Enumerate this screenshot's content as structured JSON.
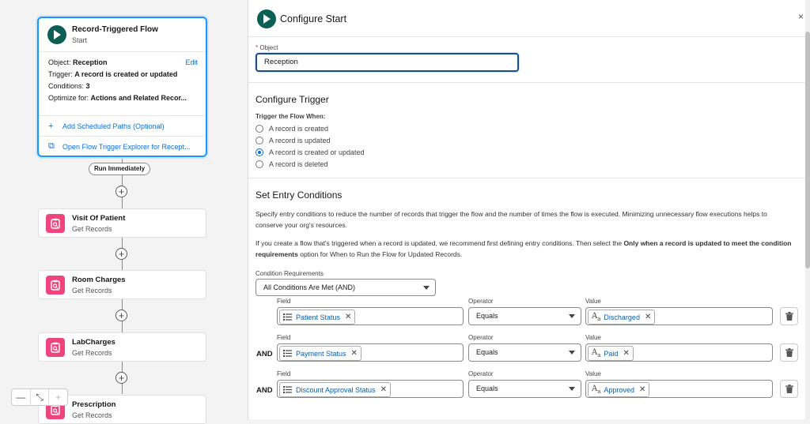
{
  "flow": {
    "start": {
      "title": "Record-Triggered Flow",
      "subtitle": "Start",
      "object_label": "Object:",
      "object_value": "Reception",
      "edit_label": "Edit",
      "trigger_label": "Trigger:",
      "trigger_value": "A record is created or updated",
      "conditions_label": "Conditions:",
      "conditions_value": "3",
      "optimize_label": "Optimize for:",
      "optimize_value": "Actions and Related Recor...",
      "scheduled_link": "Add Scheduled Paths (Optional)",
      "explorer_link": "Open Flow Trigger Explorer for Recept..."
    },
    "run_label": "Run Immediately",
    "elements": [
      {
        "title": "Visit Of Patient",
        "subtitle": "Get Records"
      },
      {
        "title": "Room Charges",
        "subtitle": "Get Records"
      },
      {
        "title": "LabCharges",
        "subtitle": "Get Records"
      },
      {
        "title": "Prescription",
        "subtitle": "Get Records"
      }
    ],
    "zoom": {
      "minus": "—",
      "fit": "⤡",
      "plus": "+"
    }
  },
  "panel": {
    "title": "Configure Start",
    "close": "×",
    "object": {
      "label": "Object",
      "required_mark": "*",
      "value": "Reception"
    },
    "trigger": {
      "section_title": "Configure Trigger",
      "label": "Trigger the Flow When:",
      "options": [
        {
          "label": "A record is created",
          "selected": false
        },
        {
          "label": "A record is updated",
          "selected": false
        },
        {
          "label": "A record is created or updated",
          "selected": true
        },
        {
          "label": "A record is deleted",
          "selected": false
        }
      ]
    },
    "entry": {
      "section_title": "Set Entry Conditions",
      "para1": "Specify entry conditions to reduce the number of records that trigger the flow and the number of times the flow is executed. Minimizing unnecessary flow executions helps to conserve your org's resources.",
      "para2_a": "If you create a flow that's triggered when a record is updated, we recommend first defining entry conditions. Then select the ",
      "para2_b": "Only when a record is updated to meet the condition requirements",
      "para2_c": " option for When to Run the Flow for Updated Records.",
      "req_label": "Condition Requirements",
      "req_value": "All Conditions Are Met (AND)",
      "col_field": "Field",
      "col_operator": "Operator",
      "col_value": "Value",
      "conditions": [
        {
          "connector": "",
          "field": "Patient Status",
          "operator": "Equals",
          "value": "Discharged"
        },
        {
          "connector": "AND",
          "field": "Payment Status",
          "operator": "Equals",
          "value": "Paid"
        },
        {
          "connector": "AND",
          "field": "Discount Approval Status",
          "operator": "Equals",
          "value": "Approved"
        }
      ]
    }
  },
  "colors": {
    "accent": "#0b6fd6",
    "start_icon": "#0b5f55",
    "element_icon": "#f0447c",
    "selected_border": "#1b96ff"
  }
}
